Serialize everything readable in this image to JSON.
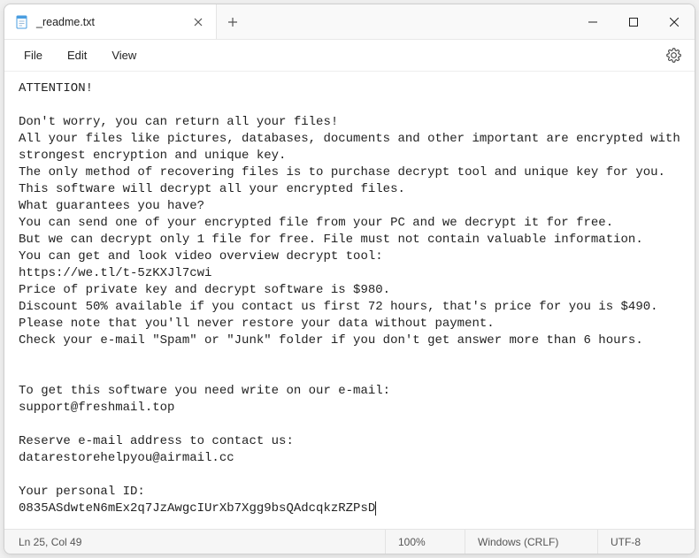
{
  "tab": {
    "title": "_readme.txt"
  },
  "menu": {
    "file": "File",
    "edit": "Edit",
    "view": "View"
  },
  "content": {
    "text": "ATTENTION!\n\nDon't worry, you can return all your files!\nAll your files like pictures, databases, documents and other important are encrypted with strongest encryption and unique key.\nThe only method of recovering files is to purchase decrypt tool and unique key for you.\nThis software will decrypt all your encrypted files.\nWhat guarantees you have?\nYou can send one of your encrypted file from your PC and we decrypt it for free.\nBut we can decrypt only 1 file for free. File must not contain valuable information.\nYou can get and look video overview decrypt tool:\nhttps://we.tl/t-5zKXJl7cwi\nPrice of private key and decrypt software is $980.\nDiscount 50% available if you contact us first 72 hours, that's price for you is $490.\nPlease note that you'll never restore your data without payment.\nCheck your e-mail \"Spam\" or \"Junk\" folder if you don't get answer more than 6 hours.\n\n\nTo get this software you need write on our e-mail:\nsupport@freshmail.top\n\nReserve e-mail address to contact us:\ndatarestorehelpyou@airmail.cc\n\nYour personal ID:\n0835ASdwteN6mEx2q7JzAwgcIUrXb7Xgg9bsQAdcqkzRZPsD"
  },
  "status": {
    "position": "Ln 25, Col 49",
    "zoom": "100%",
    "eol": "Windows (CRLF)",
    "encoding": "UTF-8"
  }
}
